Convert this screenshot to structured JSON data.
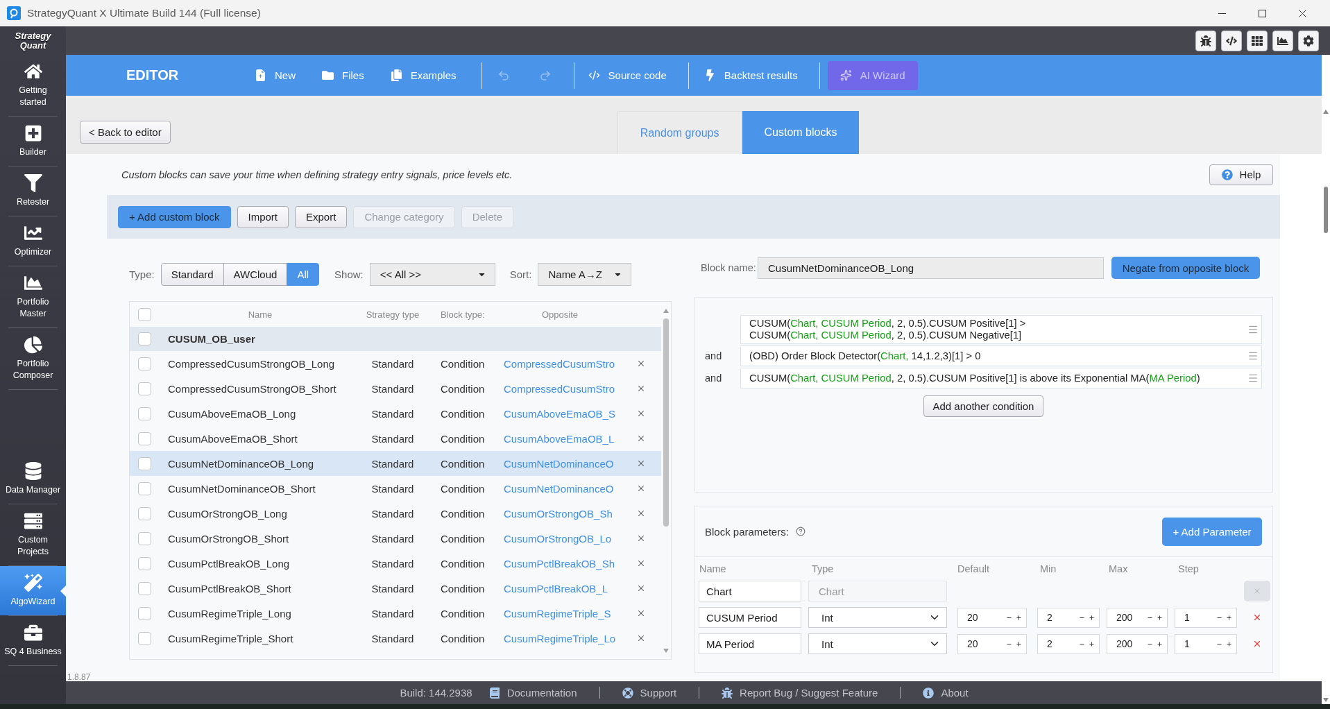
{
  "window": {
    "title": "StrategyQuant X Ultimate Build 144 (Full license)"
  },
  "sidebar": {
    "logo": "Strategy\nQuant",
    "top_items": [
      {
        "label": "Getting\nstarted",
        "selected": false
      },
      {
        "label": "Builder",
        "selected": false
      },
      {
        "label": "Retester",
        "selected": false
      },
      {
        "label": "Optimizer",
        "selected": false
      },
      {
        "label": "Portfolio\nMaster",
        "selected": false
      },
      {
        "label": "Portfolio\nComposer",
        "selected": false
      }
    ],
    "bottom_items": [
      {
        "label": "Data Manager",
        "selected": false
      },
      {
        "label": "Custom\nProjects",
        "selected": false
      },
      {
        "label": "AlgoWizard",
        "selected": true
      },
      {
        "label": "SQ 4 Business",
        "selected": false
      }
    ]
  },
  "header": {
    "title": "EDITOR",
    "file_actions": [
      {
        "label": "New"
      },
      {
        "label": "Files"
      },
      {
        "label": "Examples"
      }
    ],
    "history": [
      {
        "kind": "undo",
        "disabled": true
      },
      {
        "kind": "redo",
        "disabled": true
      }
    ],
    "tools": [
      {
        "label": "Source code"
      },
      {
        "label": "Backtest results"
      }
    ],
    "ai_button": "AI Wizard"
  },
  "back_button": "< Back to editor",
  "tabs": [
    {
      "label": "Random groups",
      "selected": false
    },
    {
      "label": "Custom blocks",
      "selected": true
    }
  ],
  "description": "Custom blocks can save your time when defining strategy entry signals, price levels etc.",
  "help_button": "Help",
  "toolbar": [
    {
      "label": "+ Add custom block",
      "kind": "primary",
      "disabled": false
    },
    {
      "label": "Import",
      "kind": "default",
      "disabled": false
    },
    {
      "label": "Export",
      "kind": "default",
      "disabled": false
    },
    {
      "label": "Change category",
      "kind": "default",
      "disabled": true
    },
    {
      "label": "Delete",
      "kind": "default",
      "disabled": true
    }
  ],
  "filters": {
    "type_label": "Type:",
    "type_options": [
      {
        "label": "Standard",
        "selected": false
      },
      {
        "label": "AWCloud",
        "selected": false
      },
      {
        "label": "All",
        "selected": true
      }
    ],
    "show_label": "Show:",
    "show_value": "<< All >>",
    "sort_label": "Sort:",
    "sort_value": "Name A→Z"
  },
  "table": {
    "select_all_checked": false,
    "columns": [
      "Name",
      "Strategy type",
      "Block type:",
      "Opposite"
    ],
    "group": {
      "name": "CUSUM_OB_user",
      "checked": false
    },
    "rows": [
      {
        "name": "CompressedCusumStrongOB_Long",
        "strategy_type": "Standard",
        "block_type": "Condition",
        "opposite": "CompressedCusumStro",
        "checked": false,
        "selected": false
      },
      {
        "name": "CompressedCusumStrongOB_Short",
        "strategy_type": "Standard",
        "block_type": "Condition",
        "opposite": "CompressedCusumStro",
        "checked": false,
        "selected": false
      },
      {
        "name": "CusumAboveEmaOB_Long",
        "strategy_type": "Standard",
        "block_type": "Condition",
        "opposite": "CusumAboveEmaOB_S",
        "checked": false,
        "selected": false
      },
      {
        "name": "CusumAboveEmaOB_Short",
        "strategy_type": "Standard",
        "block_type": "Condition",
        "opposite": "CusumAboveEmaOB_L",
        "checked": false,
        "selected": false
      },
      {
        "name": "CusumNetDominanceOB_Long",
        "strategy_type": "Standard",
        "block_type": "Condition",
        "opposite": "CusumNetDominanceO",
        "checked": false,
        "selected": true
      },
      {
        "name": "CusumNetDominanceOB_Short",
        "strategy_type": "Standard",
        "block_type": "Condition",
        "opposite": "CusumNetDominanceO",
        "checked": false,
        "selected": false
      },
      {
        "name": "CusumOrStrongOB_Long",
        "strategy_type": "Standard",
        "block_type": "Condition",
        "opposite": "CusumOrStrongOB_Sh",
        "checked": false,
        "selected": false
      },
      {
        "name": "CusumOrStrongOB_Short",
        "strategy_type": "Standard",
        "block_type": "Condition",
        "opposite": "CusumOrStrongOB_Lo",
        "checked": false,
        "selected": false
      },
      {
        "name": "CusumPctlBreakOB_Long",
        "strategy_type": "Standard",
        "block_type": "Condition",
        "opposite": "CusumPctlBreakOB_Sh",
        "checked": false,
        "selected": false
      },
      {
        "name": "CusumPctlBreakOB_Short",
        "strategy_type": "Standard",
        "block_type": "Condition",
        "opposite": "CusumPctlBreakOB_L",
        "checked": false,
        "selected": false
      },
      {
        "name": "CusumRegimeTriple_Long",
        "strategy_type": "Standard",
        "block_type": "Condition",
        "opposite": "CusumRegimeTriple_S",
        "checked": false,
        "selected": false
      },
      {
        "name": "CusumRegimeTriple_Short",
        "strategy_type": "Standard",
        "block_type": "Condition",
        "opposite": "CusumRegimeTriple_Lo",
        "checked": false,
        "selected": false
      }
    ]
  },
  "block_editor": {
    "name_label": "Block name:",
    "name_value": "CusumNetDominanceOB_Long",
    "negate_button": "Negate from opposite block",
    "conditions": [
      {
        "lines": [
          [
            {
              "text": "CUSUM(",
              "kind": "plain"
            },
            {
              "text": "Chart, CUSUM Period",
              "kind": "param"
            },
            {
              "text": ", 2, 0.5).CUSUM Positive[1] >",
              "kind": "plain"
            }
          ],
          [
            {
              "text": "CUSUM(",
              "kind": "plain"
            },
            {
              "text": "Chart, CUSUM Period",
              "kind": "param"
            },
            {
              "text": ", 2, 0.5).CUSUM Negative[1]",
              "kind": "plain"
            }
          ]
        ]
      },
      {
        "connector": "and",
        "lines": [
          [
            {
              "text": "(OBD) Order Block Detector(",
              "kind": "plain"
            },
            {
              "text": "Chart,",
              "kind": "param"
            },
            {
              "text": " 14,1.2,3)[1] > 0",
              "kind": "plain"
            }
          ]
        ]
      },
      {
        "connector": "and",
        "lines": [
          [
            {
              "text": "CUSUM(",
              "kind": "plain"
            },
            {
              "text": "Chart, CUSUM Period",
              "kind": "param"
            },
            {
              "text": ", 2, 0.5).CUSUM Positive[1] is above its Exponential MA(",
              "kind": "plain"
            },
            {
              "text": "MA Period",
              "kind": "param"
            },
            {
              "text": ")",
              "kind": "plain"
            }
          ]
        ]
      }
    ],
    "add_condition_button": "Add another condition"
  },
  "parameters": {
    "title": "Block parameters:",
    "add_button": "+ Add Parameter",
    "columns": [
      "Name",
      "Type",
      "Default",
      "Min",
      "Max",
      "Step"
    ],
    "rows": [
      {
        "kind": "fixed",
        "name": "Chart",
        "type": "Chart"
      },
      {
        "kind": "number",
        "name": "CUSUM Period",
        "type": "Int",
        "default": "20",
        "min": "2",
        "max": "200",
        "step": "1"
      },
      {
        "kind": "number",
        "name": "MA Period",
        "type": "Int",
        "default": "20",
        "min": "2",
        "max": "200",
        "step": "1"
      }
    ]
  },
  "version": "1.8.87",
  "status_bar": {
    "build": "Build: 144.2938",
    "links": [
      "Documentation",
      "Support",
      "Report Bug / Suggest Feature",
      "About"
    ]
  }
}
